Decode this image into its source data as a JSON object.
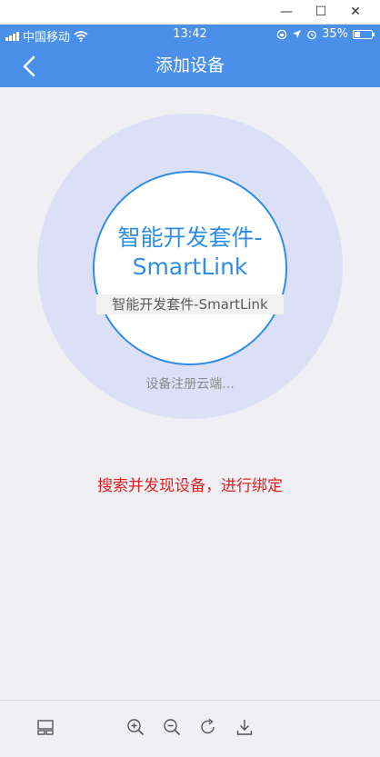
{
  "window": {
    "minimize_glyph": "—",
    "maximize_glyph": "☐",
    "close_glyph": "✕"
  },
  "status_bar": {
    "carrier": "中国移动",
    "time": "13:42",
    "battery_percent": "35%",
    "battery_level": 0.35,
    "icons": [
      "signal-icon",
      "wifi-icon",
      "rotation-lock-icon",
      "location-icon",
      "alarm-icon",
      "battery-icon"
    ]
  },
  "nav": {
    "title": "添加设备",
    "back_icon": "chevron-left-icon"
  },
  "device": {
    "name": "智能开发套件-SmartLink",
    "subtitle": "智能开发套件-SmartLink",
    "status": "设备注册云端..."
  },
  "hint": "搜索并发现设备，进行绑定",
  "toolbar": {
    "icons": [
      "panel-icon",
      "zoom-in-icon",
      "zoom-out-icon",
      "rotate-icon",
      "download-icon"
    ]
  },
  "colors": {
    "accent": "#4a90e8",
    "circle_outer": "#dbe0f6",
    "circle_border": "#2f8de4",
    "hint": "#e02020"
  }
}
